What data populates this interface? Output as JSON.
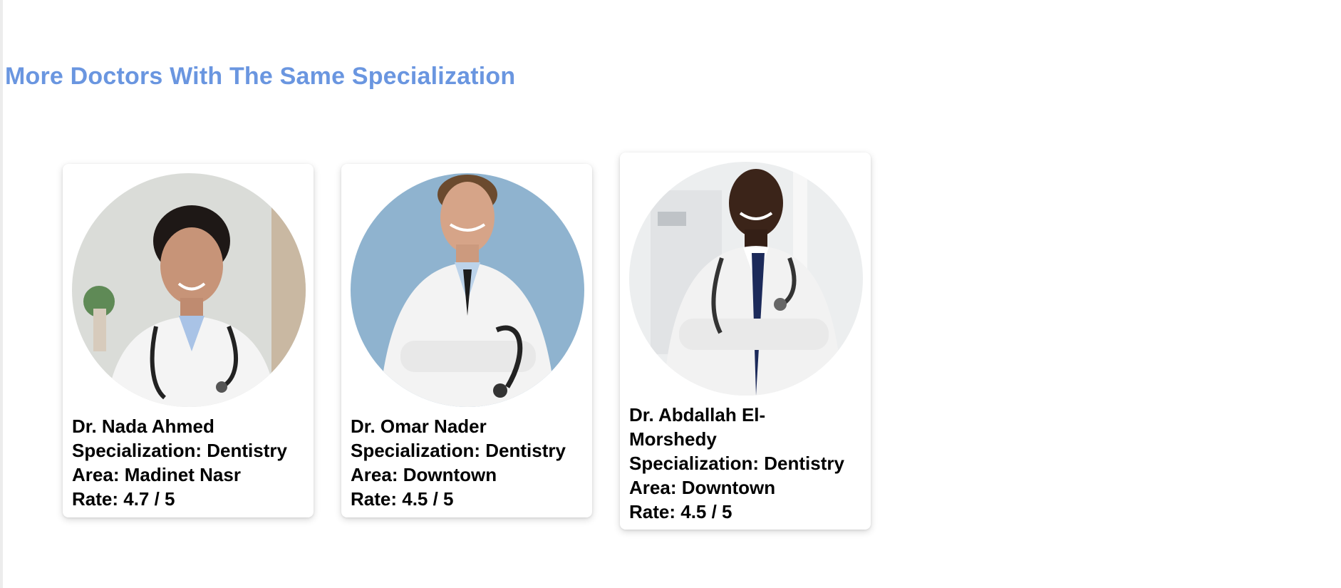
{
  "section": {
    "title": "More Doctors With The Same Specialization"
  },
  "doctors": [
    {
      "name": "Dr. Nada Ahmed",
      "specialization": "Specialization: Dentistry",
      "area": "Area: Madinet Nasr",
      "rate": "Rate: 4.7 / 5",
      "photo_bg": "#d9dcd8"
    },
    {
      "name": "Dr. Omar Nader",
      "specialization": "Specialization: Dentistry",
      "area": "Area: Downtown",
      "rate": "Rate: 4.5 / 5",
      "photo_bg": "#8fb3cf"
    },
    {
      "name": "Dr. Abdallah El-Morshedy",
      "specialization": "Specialization: Dentistry",
      "area": "Area: Downtown",
      "rate": "Rate: 4.5 / 5",
      "photo_bg": "#eceeef"
    }
  ],
  "colors": {
    "title": "#6a96e0",
    "text": "#000000"
  }
}
